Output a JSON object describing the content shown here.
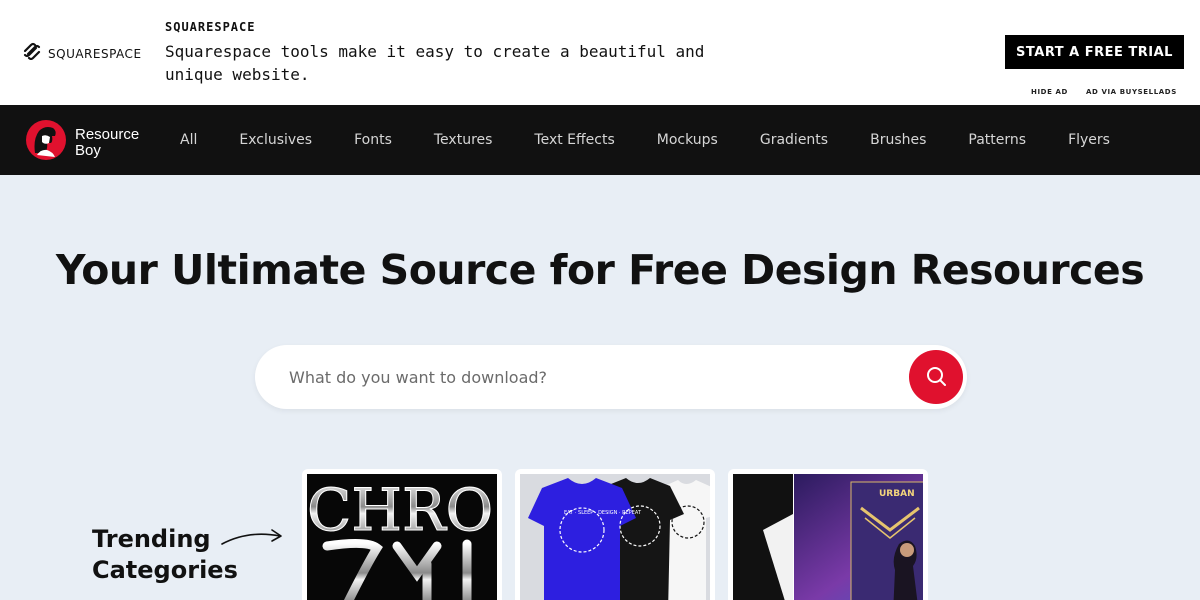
{
  "ad": {
    "logo_text": "SQUARESPACE",
    "brand": "SQUARESPACE",
    "description": "Squarespace tools make it easy to create a beautiful and unique website.",
    "cta": "START A FREE TRIAL",
    "hide_ad": "HIDE AD",
    "ad_via": "AD VIA BUYSELLADS"
  },
  "nav": {
    "logo_line1": "Resource",
    "logo_line2": "Boy",
    "links": [
      "All",
      "Exclusives",
      "Fonts",
      "Textures",
      "Text Effects",
      "Mockups",
      "Gradients",
      "Brushes",
      "Patterns",
      "Flyers"
    ]
  },
  "hero": {
    "title": "Your Ultimate Source for Free Design Resources",
    "search_placeholder": "What do you want to download?"
  },
  "trending": {
    "title_line1": "Trending",
    "title_line2": "Categories",
    "cards": [
      {
        "text": "CHRO"
      },
      {
        "text": "EAT · SLEEP · DESIGN · REPEAT"
      },
      {
        "text": "URBAN"
      }
    ]
  },
  "colors": {
    "accent": "#e0112e",
    "nav_bg": "#111111",
    "page_bg": "#e8eef5",
    "tshirt_blue": "#2d1fe0"
  },
  "icons": {
    "ad_logo": "squarespace-logo-icon",
    "site_logo": "resource-boy-logo-icon",
    "search": "search-icon",
    "arrow": "curved-arrow-icon"
  }
}
